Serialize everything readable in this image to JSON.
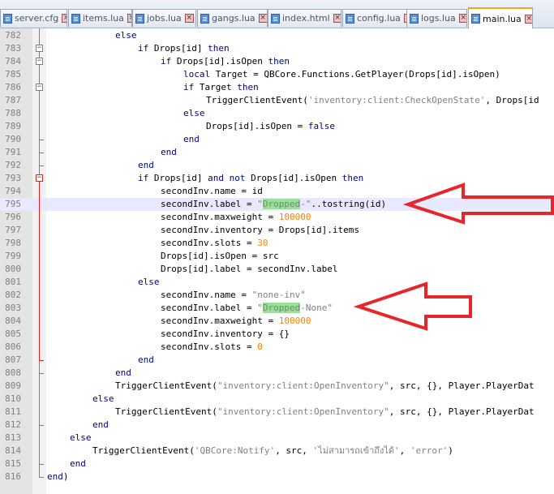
{
  "tabs": [
    {
      "label": "server.cfg",
      "active": false
    },
    {
      "label": "items.lua",
      "active": false
    },
    {
      "label": "jobs.lua",
      "active": false
    },
    {
      "label": "gangs.lua",
      "active": false
    },
    {
      "label": "index.html",
      "active": false
    },
    {
      "label": "config.lua",
      "active": false
    },
    {
      "label": "logs.lua",
      "active": false
    },
    {
      "label": "main.lua",
      "active": true
    }
  ],
  "editor": {
    "current_line": "795",
    "lines": [
      {
        "n": "782",
        "indent": 12,
        "tokens": [
          {
            "t": "else",
            "c": "kw"
          }
        ]
      },
      {
        "n": "783",
        "indent": 16,
        "tokens": [
          {
            "t": "if",
            "c": "kw"
          },
          {
            "t": " Drops[id] "
          },
          {
            "t": "then",
            "c": "kw"
          }
        ]
      },
      {
        "n": "784",
        "indent": 20,
        "tokens": [
          {
            "t": "if",
            "c": "kw"
          },
          {
            "t": " Drops[id].isOpen "
          },
          {
            "t": "then",
            "c": "kw"
          }
        ]
      },
      {
        "n": "785",
        "indent": 24,
        "tokens": [
          {
            "t": "local",
            "c": "kw"
          },
          {
            "t": " Target = QBCore.Functions.GetPlayer(Drops[id].isOpen)"
          }
        ]
      },
      {
        "n": "786",
        "indent": 24,
        "tokens": [
          {
            "t": "if",
            "c": "kw"
          },
          {
            "t": " Target "
          },
          {
            "t": "then",
            "c": "kw"
          }
        ]
      },
      {
        "n": "787",
        "indent": 28,
        "tokens": [
          {
            "t": "TriggerClientEvent("
          },
          {
            "t": "'inventory:client:CheckOpenState'",
            "c": "str"
          },
          {
            "t": ", Drops[id"
          }
        ]
      },
      {
        "n": "788",
        "indent": 24,
        "tokens": [
          {
            "t": "else",
            "c": "kw"
          }
        ]
      },
      {
        "n": "789",
        "indent": 28,
        "tokens": [
          {
            "t": "Drops[id].isOpen = "
          },
          {
            "t": "false",
            "c": "kw"
          }
        ]
      },
      {
        "n": "790",
        "indent": 24,
        "tokens": [
          {
            "t": "end",
            "c": "kw"
          }
        ]
      },
      {
        "n": "791",
        "indent": 20,
        "tokens": [
          {
            "t": "end",
            "c": "kw"
          }
        ]
      },
      {
        "n": "792",
        "indent": 16,
        "tokens": [
          {
            "t": "end",
            "c": "kw"
          }
        ]
      },
      {
        "n": "793",
        "indent": 16,
        "tokens": [
          {
            "t": "if",
            "c": "kw"
          },
          {
            "t": " Drops[id] "
          },
          {
            "t": "and",
            "c": "kw"
          },
          {
            "t": " "
          },
          {
            "t": "not",
            "c": "kw"
          },
          {
            "t": " Drops[id].isOpen "
          },
          {
            "t": "then",
            "c": "kw"
          }
        ]
      },
      {
        "n": "794",
        "indent": 20,
        "tokens": [
          {
            "t": "secondInv.name = id"
          }
        ]
      },
      {
        "n": "795",
        "indent": 20,
        "tokens": [
          {
            "t": "secondInv.label = "
          },
          {
            "t": "\"",
            "c": "str"
          },
          {
            "t": "Dropped",
            "c": "str hl"
          },
          {
            "t": "-\"",
            "c": "str"
          },
          {
            "t": "..tostring(id)"
          }
        ]
      },
      {
        "n": "796",
        "indent": 20,
        "tokens": [
          {
            "t": "secondInv.maxweight = "
          },
          {
            "t": "100000",
            "c": "num"
          }
        ]
      },
      {
        "n": "797",
        "indent": 20,
        "tokens": [
          {
            "t": "secondInv.inventory = Drops[id].items"
          }
        ]
      },
      {
        "n": "798",
        "indent": 20,
        "tokens": [
          {
            "t": "secondInv.slots = "
          },
          {
            "t": "30",
            "c": "num"
          }
        ]
      },
      {
        "n": "799",
        "indent": 20,
        "tokens": [
          {
            "t": "Drops[id].isOpen = src"
          }
        ]
      },
      {
        "n": "800",
        "indent": 20,
        "tokens": [
          {
            "t": "Drops[id].label = secondInv.label"
          }
        ]
      },
      {
        "n": "801",
        "indent": 16,
        "tokens": [
          {
            "t": "else",
            "c": "kw"
          }
        ]
      },
      {
        "n": "802",
        "indent": 20,
        "tokens": [
          {
            "t": "secondInv.name = "
          },
          {
            "t": "\"none-inv\"",
            "c": "str"
          }
        ]
      },
      {
        "n": "803",
        "indent": 20,
        "tokens": [
          {
            "t": "secondInv.label = "
          },
          {
            "t": "\"",
            "c": "str"
          },
          {
            "t": "Dropped",
            "c": "str hl"
          },
          {
            "t": "-None\"",
            "c": "str"
          }
        ]
      },
      {
        "n": "804",
        "indent": 20,
        "tokens": [
          {
            "t": "secondInv.maxweight = "
          },
          {
            "t": "100000",
            "c": "num"
          }
        ]
      },
      {
        "n": "805",
        "indent": 20,
        "tokens": [
          {
            "t": "secondInv.inventory = {}"
          }
        ]
      },
      {
        "n": "806",
        "indent": 20,
        "tokens": [
          {
            "t": "secondInv.slots = "
          },
          {
            "t": "0",
            "c": "num"
          }
        ]
      },
      {
        "n": "807",
        "indent": 16,
        "tokens": [
          {
            "t": "end",
            "c": "kw"
          }
        ]
      },
      {
        "n": "808",
        "indent": 12,
        "tokens": [
          {
            "t": "end",
            "c": "kw"
          }
        ]
      },
      {
        "n": "809",
        "indent": 12,
        "tokens": [
          {
            "t": "TriggerClientEvent("
          },
          {
            "t": "\"inventory:client:OpenInventory\"",
            "c": "str"
          },
          {
            "t": ", src, {}, Player.PlayerDat"
          }
        ]
      },
      {
        "n": "810",
        "indent": 8,
        "tokens": [
          {
            "t": "else",
            "c": "kw"
          }
        ]
      },
      {
        "n": "811",
        "indent": 12,
        "tokens": [
          {
            "t": "TriggerClientEvent("
          },
          {
            "t": "\"inventory:client:OpenInventory\"",
            "c": "str"
          },
          {
            "t": ", src, {}, Player.PlayerDat"
          }
        ]
      },
      {
        "n": "812",
        "indent": 8,
        "tokens": [
          {
            "t": "end",
            "c": "kw"
          }
        ]
      },
      {
        "n": "813",
        "indent": 4,
        "tokens": [
          {
            "t": "else",
            "c": "kw"
          }
        ]
      },
      {
        "n": "814",
        "indent": 8,
        "tokens": [
          {
            "t": "TriggerClientEvent("
          },
          {
            "t": "'QBCore:Notify'",
            "c": "str"
          },
          {
            "t": ", src, "
          },
          {
            "t": "'ไม่สามารถเข้าถึงได้'",
            "c": "str"
          },
          {
            "t": ", "
          },
          {
            "t": "'error'",
            "c": "str"
          },
          {
            "t": ")"
          }
        ]
      },
      {
        "n": "815",
        "indent": 4,
        "tokens": [
          {
            "t": "end",
            "c": "kw"
          }
        ]
      },
      {
        "n": "816",
        "indent": 0,
        "tokens": [
          {
            "t": "end",
            "c": "kw"
          },
          {
            "t": ")"
          }
        ]
      }
    ]
  },
  "annotations": {
    "color": "#e8252a"
  }
}
